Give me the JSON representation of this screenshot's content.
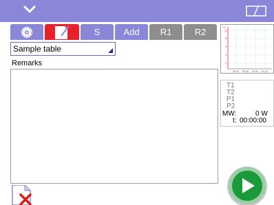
{
  "tabs": {
    "settings_icon": "gear-icon",
    "notes_icon": "edit-note-icon",
    "s_label": "S",
    "add_label": "Add",
    "r1_label": "R1",
    "r2_label": "R2"
  },
  "selector": {
    "value": "Sample table"
  },
  "remarks": {
    "label": "Remarks",
    "value": ""
  },
  "graph": {
    "y_unit": "°C",
    "y_ticks": [
      "10",
      "8",
      "6",
      "4",
      "2"
    ],
    "x_ticks": [
      "00:20",
      "00:40",
      "01:00",
      "01:20"
    ]
  },
  "readings": {
    "t1": "T1",
    "t2": "T2",
    "p1": "P1",
    "p2": "P2",
    "mw_label": "MW:",
    "mw_value": "0 W",
    "t_label": "t:",
    "t_value": "00:00:00"
  },
  "colors": {
    "accent": "#8a86d8",
    "active_tab": "#e8202a",
    "inactive_tab": "#8e8e8e",
    "start_button": "#1a9a3a"
  },
  "icons": {
    "menu": "chevron-down-icon",
    "window": "window-layout-icon",
    "delete_doc": "document-delete-icon",
    "start": "play-icon"
  }
}
